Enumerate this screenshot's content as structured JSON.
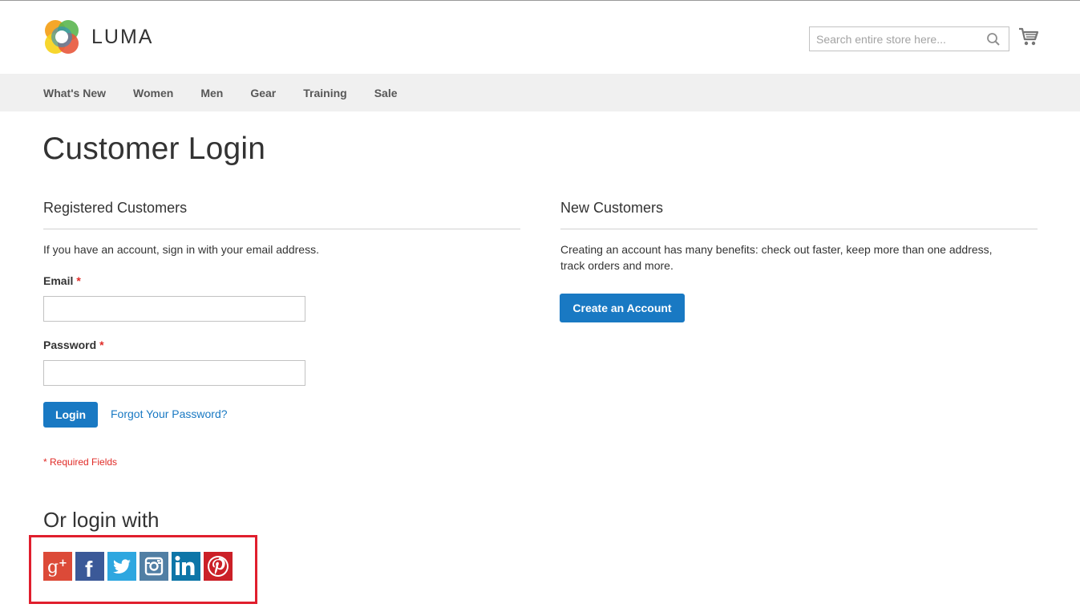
{
  "header": {
    "brand": "LUMA",
    "search": {
      "placeholder": "Search entire store here..."
    }
  },
  "nav": {
    "items": [
      "What's New",
      "Women",
      "Men",
      "Gear",
      "Training",
      "Sale"
    ]
  },
  "page": {
    "title": "Customer Login"
  },
  "registered": {
    "title": "Registered Customers",
    "intro": "If you have an account, sign in with your email address.",
    "email_label": "Email",
    "password_label": "Password",
    "required_marker": "*",
    "login_button": "Login",
    "forgot_link": "Forgot Your Password?",
    "required_note": "* Required Fields"
  },
  "new_customers": {
    "title": "New Customers",
    "intro_line1": "Creating an account has many benefits: check out faster, keep more than one address,",
    "intro_line2": "track orders and more.",
    "create_button": "Create an Account"
  },
  "social": {
    "title": "Or login with",
    "icons": [
      "google-plus-icon",
      "facebook-icon",
      "twitter-icon",
      "instagram-icon",
      "linkedin-icon",
      "pinterest-icon"
    ],
    "colors": {
      "google_plus": "#dc4a38",
      "facebook": "#3b5998",
      "twitter": "#2ea7e0",
      "instagram": "#517fa4",
      "linkedin": "#0e76a8",
      "pinterest": "#cb2027"
    }
  },
  "colors": {
    "accent": "#1979c3",
    "required": "#e02b27",
    "nav_bg": "#f0f0f0",
    "highlight": "#e01e2d"
  }
}
